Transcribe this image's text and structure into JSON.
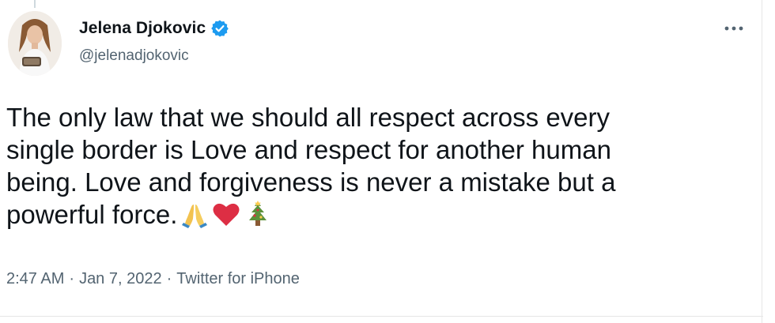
{
  "tweet": {
    "author": {
      "display_name": "Jelena Djokovic",
      "handle": "@jelenadjokovic",
      "verified": true,
      "avatar_icon": "profile-photo"
    },
    "more_icon": "ellipsis-icon",
    "text": "The only law that we should all respect across every\nsingle border is Love and respect for another human\nbeing. Love and forgiveness is never a mistake but a\npowerful force.",
    "emojis": [
      "folded-hands",
      "red-heart",
      "christmas-tree"
    ],
    "timestamp": "2:47 AM",
    "separator": "·",
    "date": "Jan 7, 2022",
    "source": "Twitter for iPhone"
  },
  "colors": {
    "verified_blue": "#1d9bf0",
    "secondary_text": "#536471",
    "primary_text": "#0f1419"
  }
}
